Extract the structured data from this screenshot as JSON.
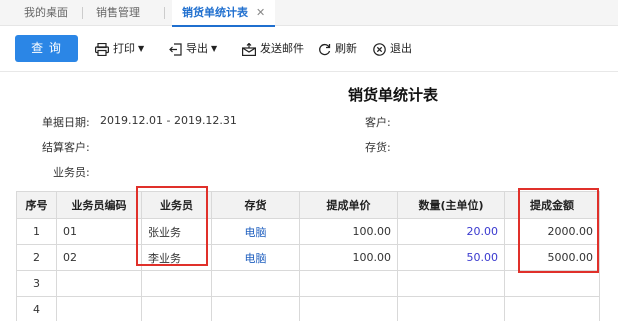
{
  "tabs": [
    {
      "label": "我的桌面"
    },
    {
      "label": "销售管理"
    },
    {
      "label": "销货单统计表",
      "close": "✕"
    }
  ],
  "toolbar": {
    "query": "查 询",
    "print": "打印",
    "export": "导出",
    "send_mail": "发送邮件",
    "refresh": "刷新",
    "exit": "退出"
  },
  "report": {
    "title": "销货单统计表",
    "filters": {
      "date_label": "单据日期:",
      "date_value": "2019.12.01 - 2019.12.31",
      "customer_label": "客户:",
      "settle_customer_label": "结算客户:",
      "stock_label": "存货:",
      "salesman_label": "业务员:"
    }
  },
  "table": {
    "headers": [
      "序号",
      "业务员编码",
      "业务员",
      "存货",
      "提成单价",
      "数量(主单位)",
      "提成金额"
    ],
    "rows": [
      {
        "seq": "1",
        "code": "01",
        "salesman": "张业务",
        "stock": "电脑",
        "unit_price": "100.00",
        "qty": "20.00",
        "amount": "2000.00"
      },
      {
        "seq": "2",
        "code": "02",
        "salesman": "李业务",
        "stock": "电脑",
        "unit_price": "100.00",
        "qty": "50.00",
        "amount": "5000.00"
      },
      {
        "seq": "3",
        "code": "",
        "salesman": "",
        "stock": "",
        "unit_price": "",
        "qty": "",
        "amount": ""
      },
      {
        "seq": "4",
        "code": "",
        "salesman": "",
        "stock": "",
        "unit_price": "",
        "qty": "",
        "amount": ""
      }
    ]
  },
  "colors": {
    "accent": "#2b86e6",
    "highlight": "#e0302a",
    "link": "#1f5fbf"
  },
  "icons": [
    "printer-icon",
    "export-icon",
    "mail-icon",
    "refresh-icon",
    "exit-icon"
  ]
}
